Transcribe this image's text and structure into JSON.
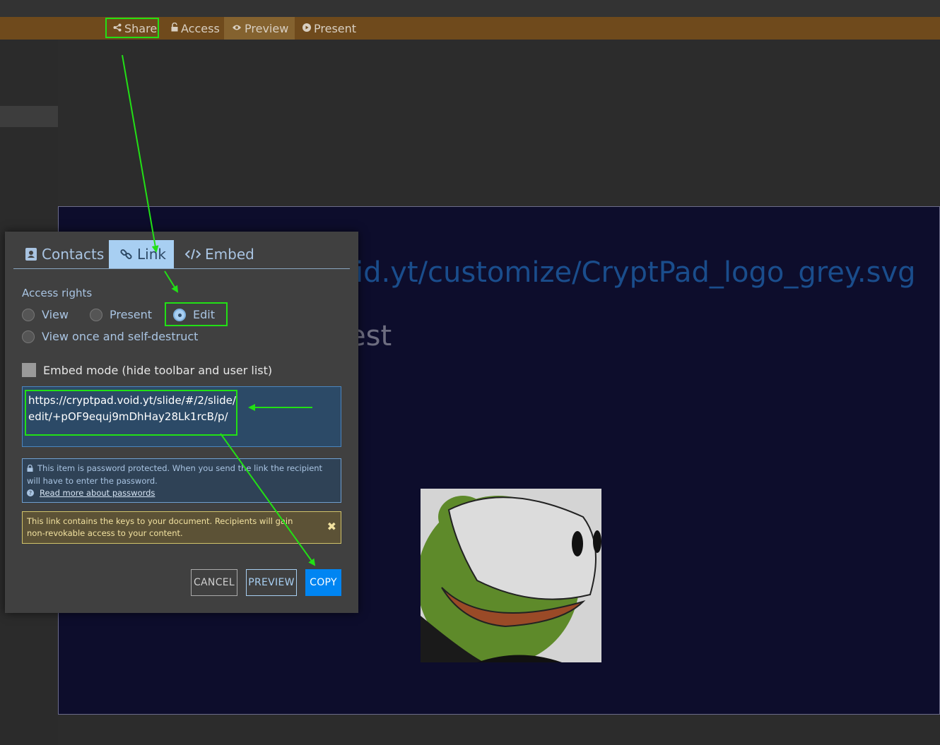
{
  "toolbar": {
    "buttons": [
      {
        "label": "Share",
        "icon": "share-icon"
      },
      {
        "label": "Access",
        "icon": "lock-icon"
      },
      {
        "label": "Preview",
        "icon": "eye-icon"
      },
      {
        "label": "Present",
        "icon": "play-icon"
      }
    ]
  },
  "slide": {
    "url_text": "id.yt/customize/CryptPad_logo_grey.svg",
    "partial_text": "est"
  },
  "modal": {
    "tabs": [
      {
        "label": "Contacts",
        "icon": "contacts-icon"
      },
      {
        "label": "Link",
        "icon": "link-icon"
      },
      {
        "label": "Embed",
        "icon": "embed-code-icon"
      }
    ],
    "active_tab": "Link",
    "access_label": "Access rights",
    "access_options": [
      {
        "label": "View",
        "checked": false
      },
      {
        "label": "Present",
        "checked": false
      },
      {
        "label": "Edit",
        "checked": true
      },
      {
        "label": "View once and self-destruct",
        "checked": false
      }
    ],
    "embed_mode_label": "Embed mode (hide toolbar and user list)",
    "link": "https://cryptpad.void.yt/slide/#/2/slide/edit/+pOF9equj9mDhHay28Lk1rcB/p/",
    "password_notice": "This item is password protected. When you send the link the recipient will have to enter the password.",
    "password_link": "Read more about passwords",
    "warning": "This link contains the keys to your document. Recipients will gain non-revokable access to your content.",
    "buttons": {
      "cancel": "CANCEL",
      "preview": "PREVIEW",
      "copy": "COPY"
    }
  },
  "colors": {
    "toolbar": "#6f4a1c",
    "accent": "#0085f2",
    "annotation": "#22e015"
  }
}
